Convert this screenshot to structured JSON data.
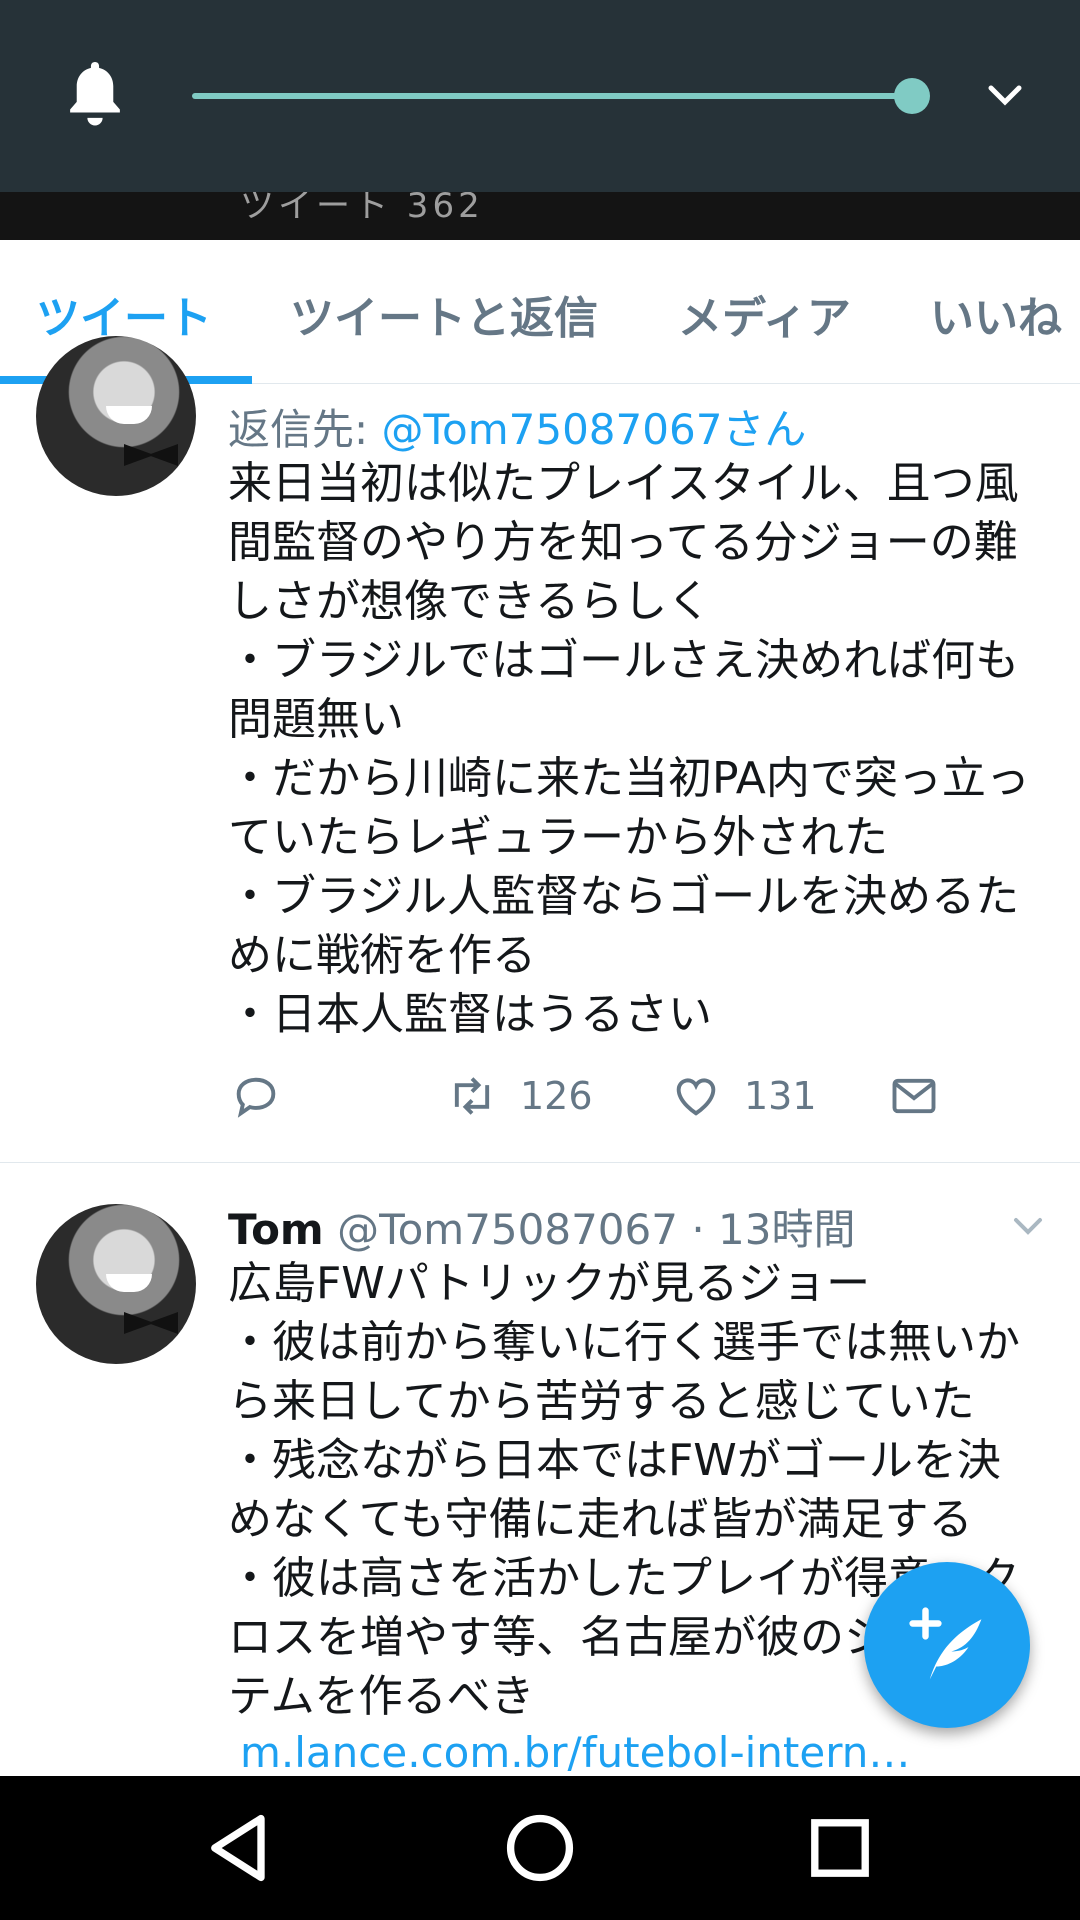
{
  "volume": {
    "level": 1.0,
    "accent": "#80cbc4",
    "bg": "#263238"
  },
  "header": {
    "remnant_text": "ツイート 362"
  },
  "tabs": [
    {
      "label": "ツイート",
      "active": true
    },
    {
      "label": "ツイートと返信",
      "active": false
    },
    {
      "label": "メディア",
      "active": false
    },
    {
      "label": "いいね",
      "active": false
    }
  ],
  "tweet1": {
    "reply_prefix": "返信先: ",
    "reply_handle": "@Tom75087067さん",
    "text": "来日当初は似たプレイスタイル、且つ風\n間監督のやり方を知ってる分ジョーの難\nしさが想像できるらしく\n・ブラジルではゴールさえ決めれば何も\n問題無い\n・だから川崎に来た当初PA内で突っ立っ\nていたらレギュラーから外された\n・ブラジル人監督ならゴールを決めるた\nめに戦術を作る\n・日本人監督はうるさい",
    "retweets": "126",
    "likes": "131"
  },
  "tweet2": {
    "name": "Tom",
    "handle": "@Tom75087067",
    "time": " · 13時間",
    "text": "広島FWパトリックが見るジョー\n・彼は前から奪いに行く選手では無いか\nら来日してから苦労すると感じていた\n・残念ながら日本ではFWがゴールを決\nめなくても守備に走れば皆が満足する\n・彼は高さを活かしたプレイが得意、ク\nロスを増やす等、名古屋が彼のシス\nテムを作るべき",
    "link": "m.lance.com.br/futebol-intern…"
  },
  "icons": {
    "bell": "bell-icon",
    "chevron": "chevron-down-icon",
    "reply": "reply-icon",
    "retweet": "retweet-icon",
    "like": "heart-icon",
    "dm": "envelope-icon",
    "compose": "compose-tweet-icon",
    "back": "back-triangle-icon",
    "home": "home-circle-icon",
    "recents": "recents-square-icon"
  },
  "colors": {
    "accent": "#1da1f2",
    "secondary": "#657786",
    "text": "#14171a"
  }
}
